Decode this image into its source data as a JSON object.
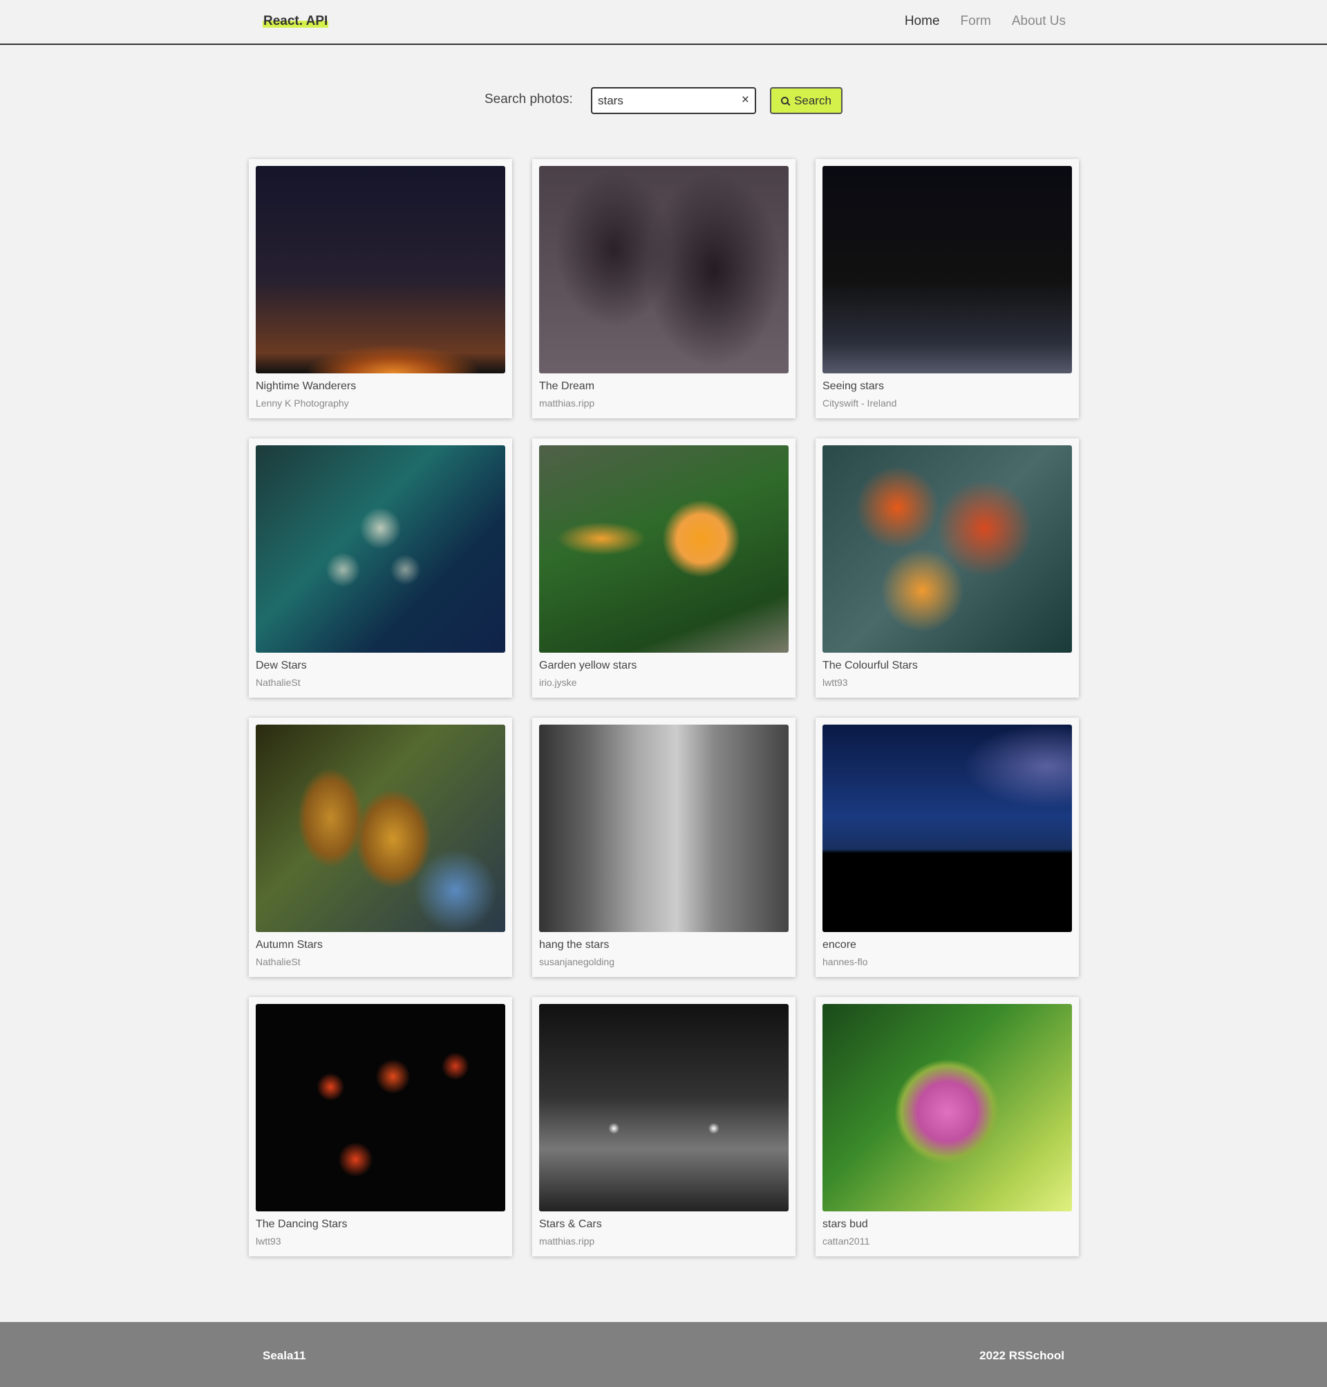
{
  "header": {
    "logo": "React. API",
    "nav": [
      {
        "label": "Home",
        "active": true
      },
      {
        "label": "Form",
        "active": false
      },
      {
        "label": "About Us",
        "active": false
      }
    ]
  },
  "search": {
    "label": "Search photos:",
    "value": "stars",
    "clear_icon": "×",
    "button_label": "Search"
  },
  "photos": [
    {
      "title": "Nightime Wanderers",
      "author": "Lenny K Photography"
    },
    {
      "title": "The Dream",
      "author": "matthias.ripp"
    },
    {
      "title": "Seeing stars",
      "author": "Cityswift - Ireland"
    },
    {
      "title": "Dew Stars",
      "author": "NathalieSt"
    },
    {
      "title": "Garden yellow stars",
      "author": "irio.jyske"
    },
    {
      "title": "The Colourful Stars",
      "author": "lwtt93"
    },
    {
      "title": "Autumn Stars",
      "author": "NathalieSt"
    },
    {
      "title": "hang the stars",
      "author": "susanjanegolding"
    },
    {
      "title": "encore",
      "author": "hannes-flo"
    },
    {
      "title": "The Dancing Stars",
      "author": "lwtt93"
    },
    {
      "title": "Stars & Cars",
      "author": "matthias.ripp"
    },
    {
      "title": "stars bud",
      "author": "cattan2011"
    }
  ],
  "footer": {
    "left": "Seala11",
    "right": "2022 RSSchool"
  },
  "colors": {
    "accent": "#d4f04a",
    "background": "#f2f2f2",
    "footer": "#808080"
  }
}
